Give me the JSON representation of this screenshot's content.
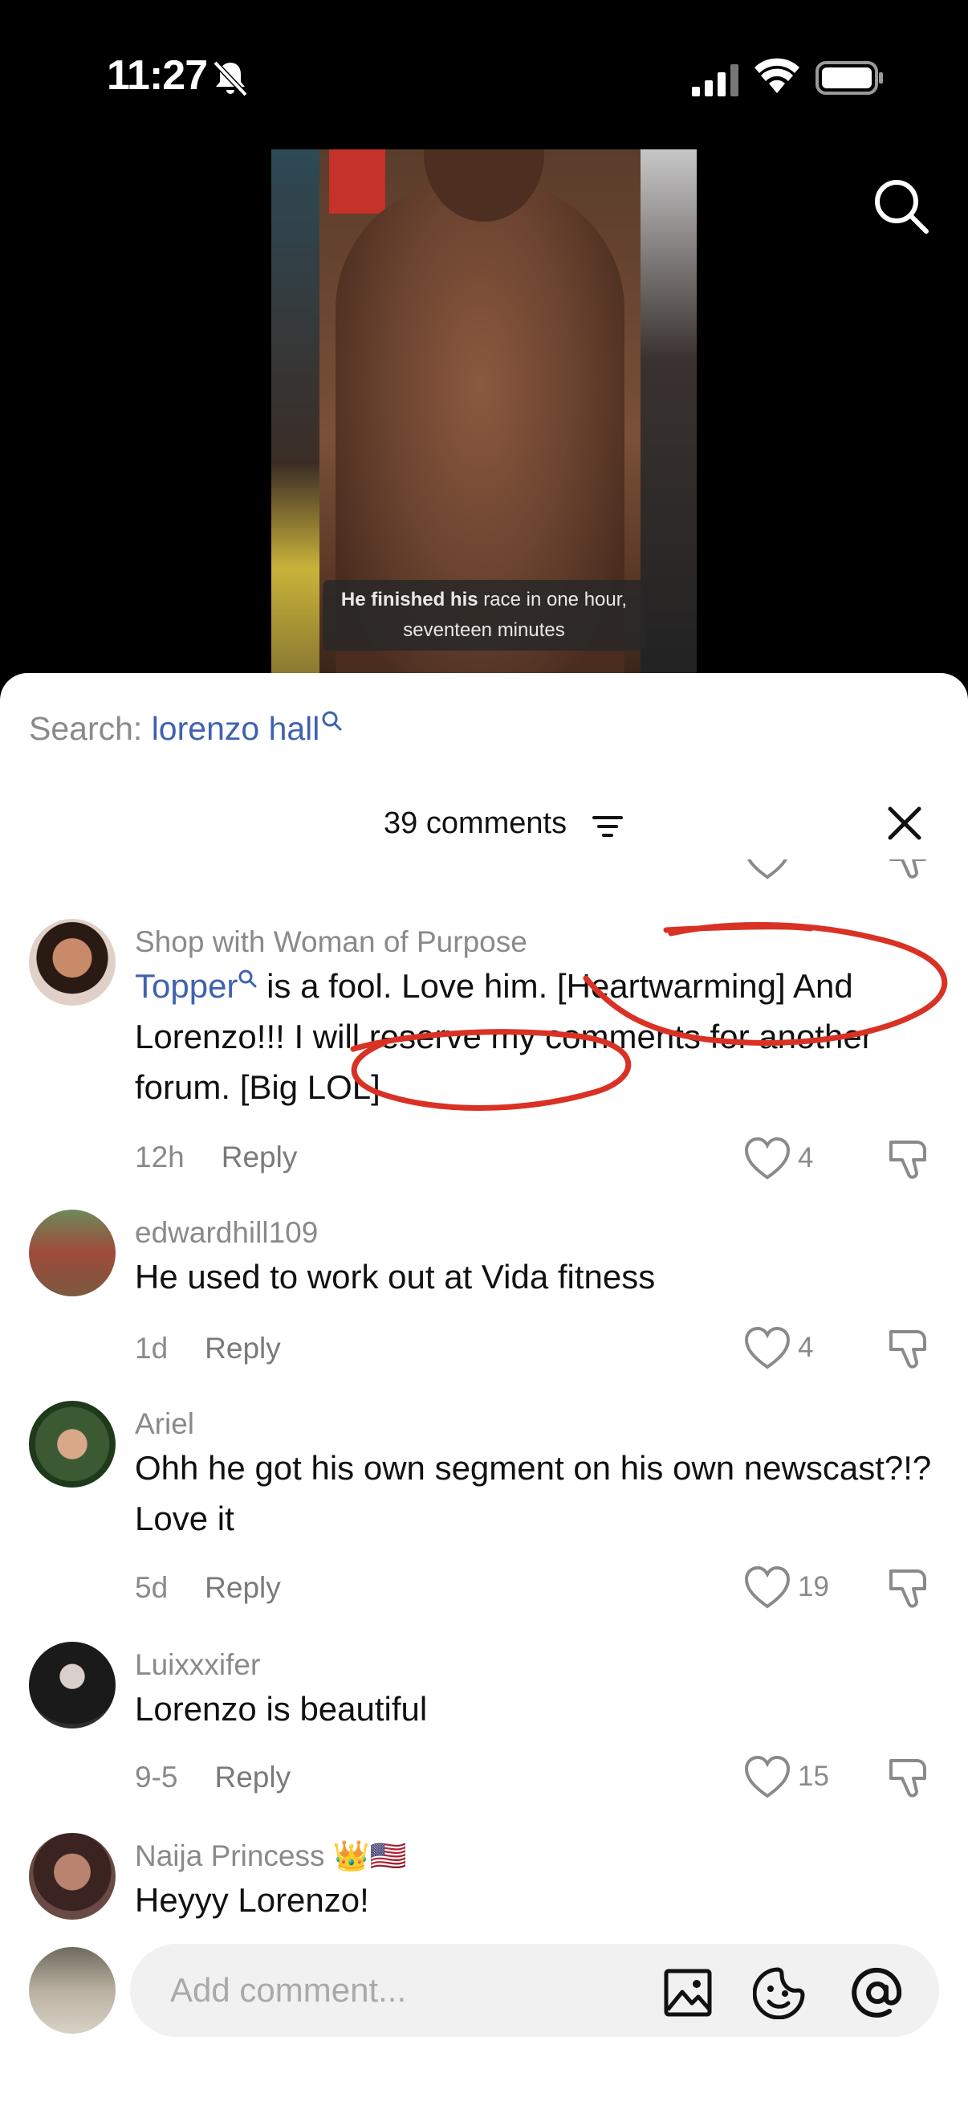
{
  "status": {
    "time": "11:27"
  },
  "video": {
    "caption_bold": "He finished his",
    "caption_rest": " race in one hour,",
    "caption_line2": "seventeen minutes"
  },
  "search": {
    "prefix": "Search: ",
    "query": "lorenzo hall"
  },
  "header": {
    "comments_count": "39 comments"
  },
  "comments": [
    {
      "username": "Shop with Woman of Purpose",
      "mention": "Topper",
      "text": " is a fool. Love him. [Heartwarming] And Lorenzo!!! I will reserve my comments for another forum. [Big LOL]",
      "time": "12h",
      "reply": "Reply",
      "likes": "4"
    },
    {
      "username": "edwardhill109",
      "text": "He used to work out at Vida fitness",
      "time": "1d",
      "reply": "Reply",
      "likes": "4"
    },
    {
      "username": "Ariel",
      "text": "Ohh he got his own segment on his own newscast?!? Love it",
      "time": "5d",
      "reply": "Reply",
      "likes": "19"
    },
    {
      "username": "Luixxxifer",
      "text": "Lorenzo is beautiful",
      "time": "9-5",
      "reply": "Reply",
      "likes": "15"
    },
    {
      "username": "Naija Princess 👑🇺🇸",
      "text": "Heyyy Lorenzo!"
    }
  ],
  "composer": {
    "placeholder": "Add comment..."
  },
  "colors": {
    "link": "#3f62b0",
    "annotation": "#d93224"
  }
}
